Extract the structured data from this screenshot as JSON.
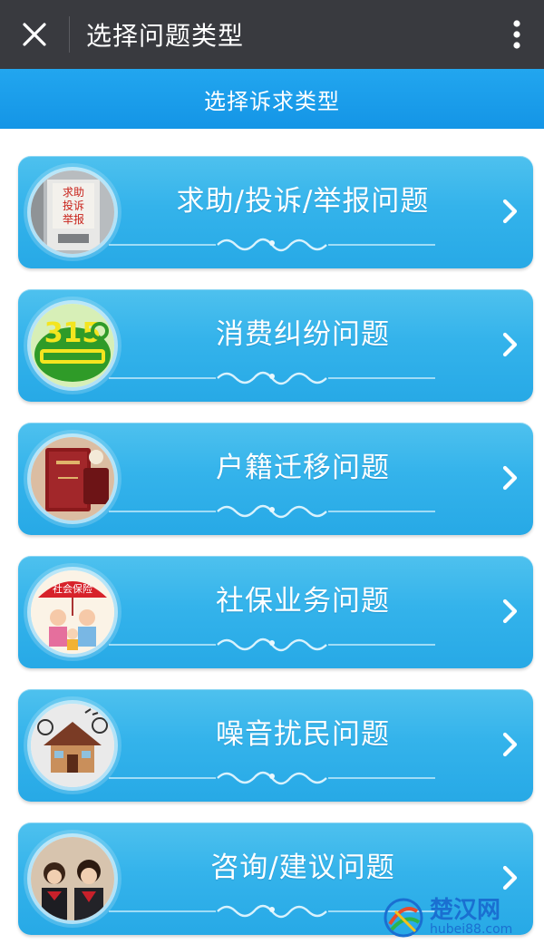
{
  "topbar": {
    "title": "选择问题类型",
    "close_icon": "close-icon",
    "more_icon": "more-vertical-icon"
  },
  "subheader": {
    "title": "选择诉求类型"
  },
  "items": [
    {
      "label": "求助/投诉/举报问题",
      "icon": "help-complaint-report-icon",
      "icon_text": "求助 投诉 举报"
    },
    {
      "label": "消费纠纷问题",
      "icon": "consumer-315-icon",
      "icon_text": "315"
    },
    {
      "label": "户籍迁移问题",
      "icon": "household-register-icon",
      "icon_text": ""
    },
    {
      "label": "社保业务问题",
      "icon": "social-insurance-icon",
      "icon_text": "社会保险"
    },
    {
      "label": "噪音扰民问题",
      "icon": "noise-house-icon",
      "icon_text": ""
    },
    {
      "label": "咨询/建议问题",
      "icon": "consulting-people-icon",
      "icon_text": ""
    }
  ],
  "watermark": {
    "title": "楚汉网",
    "subtitle": "hubei88.com"
  },
  "colors": {
    "topbar": "#393a3f",
    "subheader": "#1a9ee9",
    "card": "#2fb0ea"
  }
}
